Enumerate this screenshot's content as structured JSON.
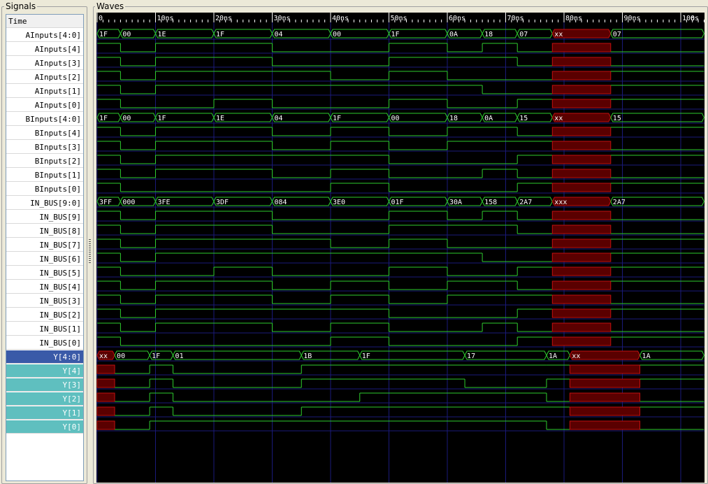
{
  "panels": {
    "signals_title": "Signals",
    "waves_title": "Waves"
  },
  "time_header": "Time",
  "time_unit": "ns",
  "time_ticks": [
    0,
    10,
    20,
    30,
    40,
    50,
    60,
    70,
    80,
    90,
    100
  ],
  "colors": {
    "wave": "#2ecc2e",
    "undefined": "#c01010",
    "grid": "#1a1a7a",
    "label": "#ffffff"
  },
  "signals": [
    {
      "name": "AInputs[4:0]",
      "kind": "bus",
      "segments": [
        [
          0,
          4,
          "1F"
        ],
        [
          4,
          10,
          "00"
        ],
        [
          10,
          20,
          "1E"
        ],
        [
          20,
          30,
          "1F"
        ],
        [
          30,
          40,
          "04"
        ],
        [
          40,
          50,
          "00"
        ],
        [
          50,
          60,
          "1F"
        ],
        [
          60,
          66,
          "0A"
        ],
        [
          66,
          72,
          "18"
        ],
        [
          72,
          78,
          "07"
        ],
        [
          78,
          88,
          "xx"
        ],
        [
          88,
          104,
          "07"
        ]
      ]
    },
    {
      "name": "AInputs[4]",
      "kind": "bit",
      "segments": [
        [
          0,
          4,
          1
        ],
        [
          4,
          10,
          0
        ],
        [
          10,
          30,
          1
        ],
        [
          30,
          50,
          0
        ],
        [
          50,
          60,
          1
        ],
        [
          60,
          66,
          0
        ],
        [
          66,
          72,
          1
        ],
        [
          72,
          78,
          0
        ],
        [
          78,
          88,
          "x"
        ],
        [
          88,
          104,
          0
        ]
      ]
    },
    {
      "name": "AInputs[3]",
      "kind": "bit",
      "segments": [
        [
          0,
          4,
          1
        ],
        [
          4,
          10,
          0
        ],
        [
          10,
          30,
          1
        ],
        [
          30,
          50,
          0
        ],
        [
          50,
          72,
          1
        ],
        [
          72,
          78,
          0
        ],
        [
          78,
          88,
          "x"
        ],
        [
          88,
          104,
          0
        ]
      ]
    },
    {
      "name": "AInputs[2]",
      "kind": "bit",
      "segments": [
        [
          0,
          4,
          1
        ],
        [
          4,
          10,
          0
        ],
        [
          10,
          40,
          1
        ],
        [
          40,
          50,
          0
        ],
        [
          50,
          60,
          1
        ],
        [
          60,
          78,
          0
        ],
        [
          78,
          88,
          "x"
        ],
        [
          88,
          104,
          1
        ]
      ]
    },
    {
      "name": "AInputs[1]",
      "kind": "bit",
      "segments": [
        [
          0,
          4,
          1
        ],
        [
          4,
          10,
          0
        ],
        [
          10,
          66,
          1
        ],
        [
          66,
          78,
          0
        ],
        [
          78,
          88,
          "x"
        ],
        [
          88,
          104,
          1
        ]
      ]
    },
    {
      "name": "AInputs[0]",
      "kind": "bit",
      "segments": [
        [
          0,
          4,
          1
        ],
        [
          4,
          20,
          0
        ],
        [
          20,
          30,
          1
        ],
        [
          30,
          50,
          0
        ],
        [
          50,
          60,
          1
        ],
        [
          60,
          72,
          0
        ],
        [
          72,
          78,
          1
        ],
        [
          78,
          88,
          "x"
        ],
        [
          88,
          104,
          1
        ]
      ]
    },
    {
      "name": "BInputs[4:0]",
      "kind": "bus",
      "segments": [
        [
          0,
          4,
          "1F"
        ],
        [
          4,
          10,
          "00"
        ],
        [
          10,
          20,
          "1F"
        ],
        [
          20,
          30,
          "1E"
        ],
        [
          30,
          40,
          "04"
        ],
        [
          40,
          50,
          "1F"
        ],
        [
          50,
          60,
          "00"
        ],
        [
          60,
          66,
          "18"
        ],
        [
          66,
          72,
          "0A"
        ],
        [
          72,
          78,
          "15"
        ],
        [
          78,
          88,
          "xx"
        ],
        [
          88,
          104,
          "15"
        ]
      ]
    },
    {
      "name": "BInputs[4]",
      "kind": "bit",
      "segments": [
        [
          0,
          4,
          1
        ],
        [
          4,
          10,
          0
        ],
        [
          10,
          30,
          1
        ],
        [
          30,
          40,
          0
        ],
        [
          40,
          50,
          1
        ],
        [
          50,
          60,
          0
        ],
        [
          60,
          72,
          1
        ],
        [
          72,
          78,
          0
        ],
        [
          78,
          88,
          "x"
        ],
        [
          88,
          104,
          1
        ]
      ]
    },
    {
      "name": "BInputs[3]",
      "kind": "bit",
      "segments": [
        [
          0,
          4,
          1
        ],
        [
          4,
          10,
          0
        ],
        [
          10,
          30,
          1
        ],
        [
          30,
          40,
          0
        ],
        [
          40,
          50,
          1
        ],
        [
          50,
          60,
          0
        ],
        [
          60,
          78,
          1
        ],
        [
          78,
          88,
          "x"
        ],
        [
          88,
          104,
          0
        ]
      ]
    },
    {
      "name": "BInputs[2]",
      "kind": "bit",
      "segments": [
        [
          0,
          4,
          1
        ],
        [
          4,
          10,
          0
        ],
        [
          10,
          30,
          1
        ],
        [
          30,
          40,
          1
        ],
        [
          40,
          50,
          1
        ],
        [
          50,
          60,
          0
        ],
        [
          60,
          72,
          0
        ],
        [
          72,
          78,
          1
        ],
        [
          78,
          88,
          "x"
        ],
        [
          88,
          104,
          1
        ]
      ]
    },
    {
      "name": "BInputs[1]",
      "kind": "bit",
      "segments": [
        [
          0,
          4,
          1
        ],
        [
          4,
          10,
          0
        ],
        [
          10,
          30,
          1
        ],
        [
          30,
          40,
          0
        ],
        [
          40,
          50,
          1
        ],
        [
          50,
          66,
          0
        ],
        [
          66,
          72,
          1
        ],
        [
          72,
          78,
          0
        ],
        [
          78,
          88,
          "x"
        ],
        [
          88,
          104,
          0
        ]
      ]
    },
    {
      "name": "BInputs[0]",
      "kind": "bit",
      "segments": [
        [
          0,
          4,
          1
        ],
        [
          4,
          20,
          0
        ],
        [
          20,
          40,
          0
        ],
        [
          40,
          50,
          1
        ],
        [
          50,
          72,
          0
        ],
        [
          72,
          78,
          1
        ],
        [
          78,
          88,
          "x"
        ],
        [
          88,
          104,
          1
        ]
      ]
    },
    {
      "name": "IN_BUS[9:0]",
      "kind": "bus",
      "segments": [
        [
          0,
          4,
          "3FF"
        ],
        [
          4,
          10,
          "000"
        ],
        [
          10,
          20,
          "3FE"
        ],
        [
          20,
          30,
          "3DF"
        ],
        [
          30,
          40,
          "084"
        ],
        [
          40,
          50,
          "3E0"
        ],
        [
          50,
          60,
          "01F"
        ],
        [
          60,
          66,
          "30A"
        ],
        [
          66,
          72,
          "158"
        ],
        [
          72,
          78,
          "2A7"
        ],
        [
          78,
          88,
          "xxx"
        ],
        [
          88,
          104,
          "2A7"
        ]
      ]
    },
    {
      "name": "IN_BUS[9]",
      "kind": "bit",
      "segments": [
        [
          0,
          4,
          1
        ],
        [
          4,
          10,
          0
        ],
        [
          10,
          30,
          1
        ],
        [
          30,
          50,
          0
        ],
        [
          50,
          60,
          1
        ],
        [
          60,
          66,
          0
        ],
        [
          66,
          72,
          1
        ],
        [
          72,
          78,
          0
        ],
        [
          78,
          88,
          "x"
        ],
        [
          88,
          104,
          0
        ]
      ]
    },
    {
      "name": "IN_BUS[8]",
      "kind": "bit",
      "segments": [
        [
          0,
          4,
          1
        ],
        [
          4,
          10,
          0
        ],
        [
          10,
          30,
          1
        ],
        [
          30,
          50,
          0
        ],
        [
          50,
          72,
          1
        ],
        [
          72,
          78,
          0
        ],
        [
          78,
          88,
          "x"
        ],
        [
          88,
          104,
          0
        ]
      ]
    },
    {
      "name": "IN_BUS[7]",
      "kind": "bit",
      "segments": [
        [
          0,
          4,
          1
        ],
        [
          4,
          10,
          0
        ],
        [
          10,
          40,
          1
        ],
        [
          40,
          50,
          0
        ],
        [
          50,
          60,
          1
        ],
        [
          60,
          78,
          0
        ],
        [
          78,
          88,
          "x"
        ],
        [
          88,
          104,
          1
        ]
      ]
    },
    {
      "name": "IN_BUS[6]",
      "kind": "bit",
      "segments": [
        [
          0,
          4,
          1
        ],
        [
          4,
          10,
          0
        ],
        [
          10,
          66,
          1
        ],
        [
          66,
          78,
          0
        ],
        [
          78,
          88,
          "x"
        ],
        [
          88,
          104,
          1
        ]
      ]
    },
    {
      "name": "IN_BUS[5]",
      "kind": "bit",
      "segments": [
        [
          0,
          4,
          1
        ],
        [
          4,
          20,
          0
        ],
        [
          20,
          30,
          1
        ],
        [
          30,
          50,
          0
        ],
        [
          50,
          60,
          1
        ],
        [
          60,
          72,
          0
        ],
        [
          72,
          78,
          1
        ],
        [
          78,
          88,
          "x"
        ],
        [
          88,
          104,
          1
        ]
      ]
    },
    {
      "name": "IN_BUS[4]",
      "kind": "bit",
      "segments": [
        [
          0,
          4,
          1
        ],
        [
          4,
          10,
          0
        ],
        [
          10,
          30,
          1
        ],
        [
          30,
          40,
          0
        ],
        [
          40,
          50,
          1
        ],
        [
          50,
          60,
          0
        ],
        [
          60,
          72,
          1
        ],
        [
          72,
          78,
          0
        ],
        [
          78,
          88,
          "x"
        ],
        [
          88,
          104,
          1
        ]
      ]
    },
    {
      "name": "IN_BUS[3]",
      "kind": "bit",
      "segments": [
        [
          0,
          4,
          1
        ],
        [
          4,
          10,
          0
        ],
        [
          10,
          30,
          1
        ],
        [
          30,
          40,
          0
        ],
        [
          40,
          50,
          1
        ],
        [
          50,
          60,
          0
        ],
        [
          60,
          78,
          1
        ],
        [
          78,
          88,
          "x"
        ],
        [
          88,
          104,
          0
        ]
      ]
    },
    {
      "name": "IN_BUS[2]",
      "kind": "bit",
      "segments": [
        [
          0,
          4,
          1
        ],
        [
          4,
          10,
          0
        ],
        [
          10,
          30,
          1
        ],
        [
          30,
          40,
          1
        ],
        [
          40,
          50,
          1
        ],
        [
          50,
          72,
          0
        ],
        [
          72,
          78,
          1
        ],
        [
          78,
          88,
          "x"
        ],
        [
          88,
          104,
          1
        ]
      ]
    },
    {
      "name": "IN_BUS[1]",
      "kind": "bit",
      "segments": [
        [
          0,
          4,
          1
        ],
        [
          4,
          10,
          0
        ],
        [
          10,
          30,
          1
        ],
        [
          30,
          40,
          0
        ],
        [
          40,
          50,
          1
        ],
        [
          50,
          66,
          0
        ],
        [
          66,
          72,
          1
        ],
        [
          72,
          78,
          0
        ],
        [
          78,
          88,
          "x"
        ],
        [
          88,
          104,
          0
        ]
      ]
    },
    {
      "name": "IN_BUS[0]",
      "kind": "bit",
      "segments": [
        [
          0,
          4,
          1
        ],
        [
          4,
          20,
          0
        ],
        [
          20,
          40,
          0
        ],
        [
          40,
          50,
          1
        ],
        [
          50,
          72,
          0
        ],
        [
          72,
          78,
          1
        ],
        [
          78,
          88,
          "x"
        ],
        [
          88,
          104,
          1
        ]
      ]
    },
    {
      "name": "Y[4:0]",
      "kind": "bus",
      "style": "sel",
      "segments": [
        [
          0,
          3,
          "xx"
        ],
        [
          3,
          9,
          "00"
        ],
        [
          9,
          13,
          "1F"
        ],
        [
          13,
          35,
          "01"
        ],
        [
          35,
          45,
          "1B"
        ],
        [
          45,
          63,
          "1F"
        ],
        [
          63,
          77,
          "17"
        ],
        [
          77,
          81,
          "1A"
        ],
        [
          81,
          93,
          "xx"
        ],
        [
          93,
          104,
          "1A"
        ]
      ]
    },
    {
      "name": "Y[4]",
      "kind": "bit",
      "style": "out",
      "segments": [
        [
          0,
          3,
          "x"
        ],
        [
          3,
          9,
          0
        ],
        [
          9,
          13,
          1
        ],
        [
          13,
          35,
          0
        ],
        [
          35,
          77,
          1
        ],
        [
          77,
          81,
          1
        ],
        [
          81,
          93,
          "x"
        ],
        [
          93,
          104,
          1
        ]
      ]
    },
    {
      "name": "Y[3]",
      "kind": "bit",
      "style": "out",
      "segments": [
        [
          0,
          3,
          "x"
        ],
        [
          3,
          9,
          0
        ],
        [
          9,
          13,
          1
        ],
        [
          13,
          35,
          0
        ],
        [
          35,
          63,
          1
        ],
        [
          63,
          77,
          0
        ],
        [
          77,
          81,
          1
        ],
        [
          81,
          93,
          "x"
        ],
        [
          93,
          104,
          1
        ]
      ]
    },
    {
      "name": "Y[2]",
      "kind": "bit",
      "style": "out",
      "segments": [
        [
          0,
          3,
          "x"
        ],
        [
          3,
          9,
          0
        ],
        [
          9,
          13,
          1
        ],
        [
          13,
          45,
          0
        ],
        [
          45,
          77,
          1
        ],
        [
          77,
          81,
          0
        ],
        [
          81,
          93,
          "x"
        ],
        [
          93,
          104,
          0
        ]
      ]
    },
    {
      "name": "Y[1]",
      "kind": "bit",
      "style": "out",
      "segments": [
        [
          0,
          3,
          "x"
        ],
        [
          3,
          9,
          0
        ],
        [
          9,
          13,
          1
        ],
        [
          13,
          35,
          0
        ],
        [
          35,
          77,
          1
        ],
        [
          77,
          81,
          1
        ],
        [
          81,
          93,
          "x"
        ],
        [
          93,
          104,
          1
        ]
      ]
    },
    {
      "name": "Y[0]",
      "kind": "bit",
      "style": "out",
      "segments": [
        [
          0,
          3,
          "x"
        ],
        [
          3,
          9,
          0
        ],
        [
          9,
          77,
          1
        ],
        [
          77,
          81,
          0
        ],
        [
          81,
          93,
          "x"
        ],
        [
          93,
          104,
          0
        ]
      ]
    }
  ]
}
